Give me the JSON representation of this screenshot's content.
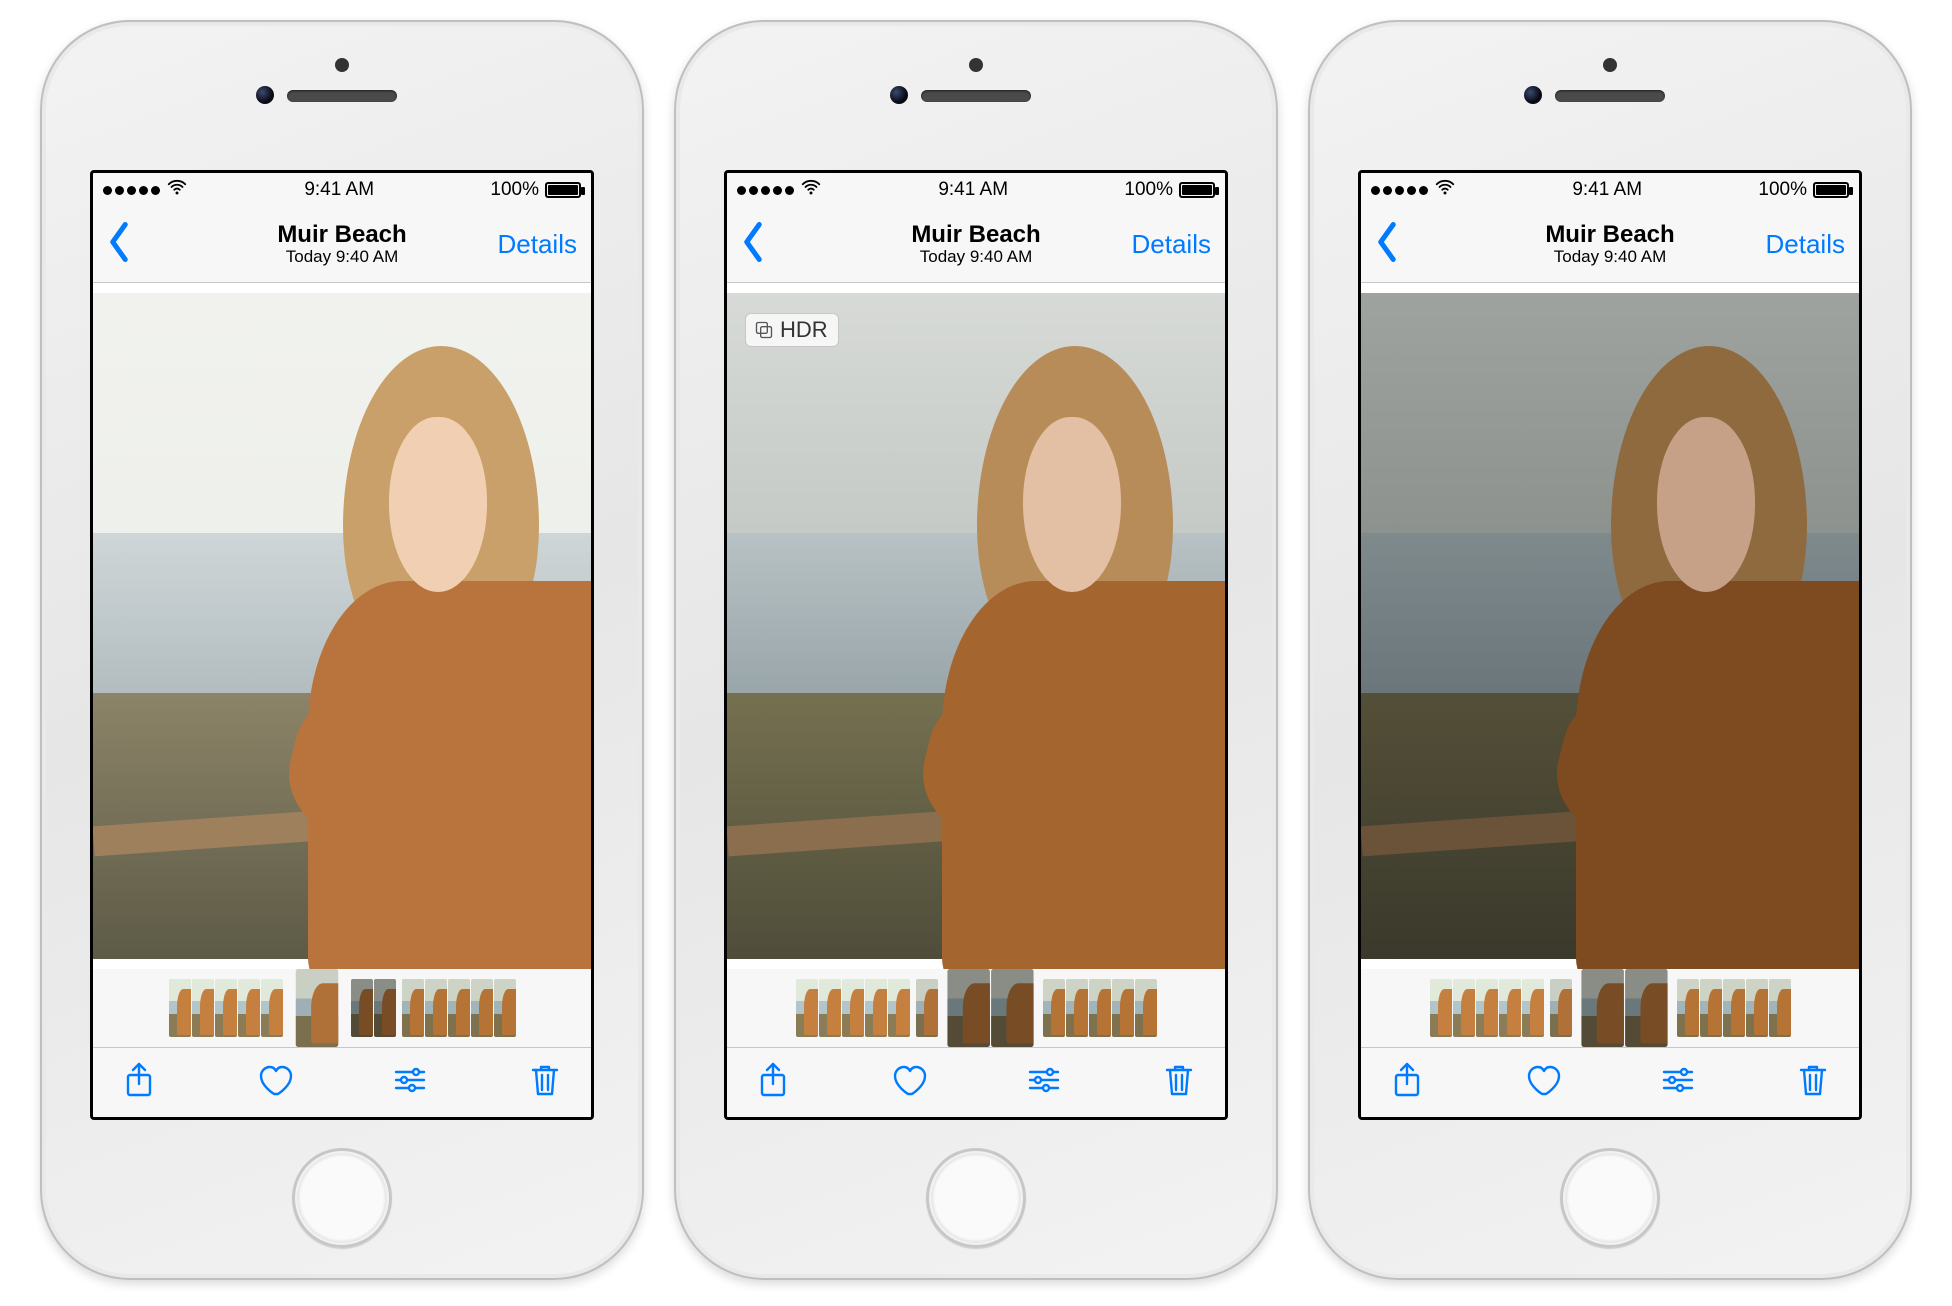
{
  "phones": [
    {
      "variant": "v1",
      "show_hdr_badge": false,
      "current_group_index": 1
    },
    {
      "variant": "v2",
      "show_hdr_badge": true,
      "current_group_index": 2
    },
    {
      "variant": "v3",
      "show_hdr_badge": false,
      "current_group_index": 2
    }
  ],
  "status": {
    "time": "9:41 AM",
    "battery_pct": "100%"
  },
  "nav": {
    "title": "Muir Beach",
    "subtitle": "Today  9:40 AM",
    "details_label": "Details"
  },
  "hdr_badge": "HDR",
  "thumbnail_groups": [
    {
      "variant_class": "g1",
      "count": 5
    },
    {
      "variant_class": "g2",
      "count": 1
    },
    {
      "variant_class": "g3",
      "count": 2
    },
    {
      "variant_class": "g4",
      "count": 5
    }
  ],
  "toolbar": {
    "share": "share-icon",
    "favorite": "heart-icon",
    "edit": "sliders-icon",
    "delete": "trash-icon"
  },
  "colors": {
    "accent": "#007aff"
  }
}
